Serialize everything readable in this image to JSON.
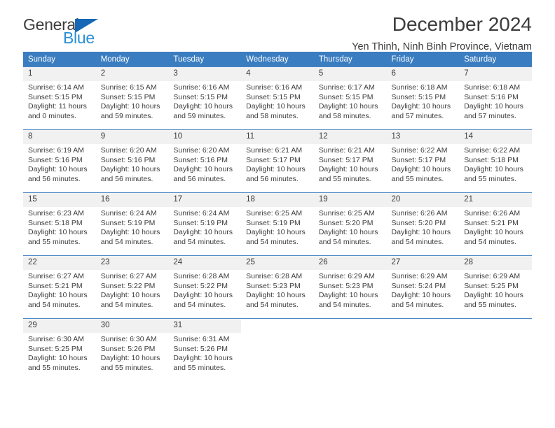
{
  "brand": {
    "word_one": "General",
    "word_two": "Blue",
    "triangle": "triangle-logo-mark"
  },
  "header": {
    "title": "December 2024",
    "subtitle": "Yen Thinh, Ninh Binh Province, Vietnam"
  },
  "colors": {
    "header_blue": "#3a7dc0",
    "row_border_blue": "#4a86c5",
    "daynum_bg": "#f1f1f1",
    "brand_blue": "#2a8fd4",
    "brand_triangle": "#1567b5",
    "text": "#3c3c3c"
  },
  "weekday_headers": [
    "Sunday",
    "Monday",
    "Tuesday",
    "Wednesday",
    "Thursday",
    "Friday",
    "Saturday"
  ],
  "labels": {
    "sunrise_prefix": "Sunrise: ",
    "sunset_prefix": "Sunset: ",
    "daylight_prefix": "Daylight: "
  },
  "weeks": [
    [
      {
        "day": "1",
        "sunrise": "Sunrise: 6:14 AM",
        "sunset": "Sunset: 5:15 PM",
        "daylight": "Daylight: 11 hours and 0 minutes."
      },
      {
        "day": "2",
        "sunrise": "Sunrise: 6:15 AM",
        "sunset": "Sunset: 5:15 PM",
        "daylight": "Daylight: 10 hours and 59 minutes."
      },
      {
        "day": "3",
        "sunrise": "Sunrise: 6:16 AM",
        "sunset": "Sunset: 5:15 PM",
        "daylight": "Daylight: 10 hours and 59 minutes."
      },
      {
        "day": "4",
        "sunrise": "Sunrise: 6:16 AM",
        "sunset": "Sunset: 5:15 PM",
        "daylight": "Daylight: 10 hours and 58 minutes."
      },
      {
        "day": "5",
        "sunrise": "Sunrise: 6:17 AM",
        "sunset": "Sunset: 5:15 PM",
        "daylight": "Daylight: 10 hours and 58 minutes."
      },
      {
        "day": "6",
        "sunrise": "Sunrise: 6:18 AM",
        "sunset": "Sunset: 5:15 PM",
        "daylight": "Daylight: 10 hours and 57 minutes."
      },
      {
        "day": "7",
        "sunrise": "Sunrise: 6:18 AM",
        "sunset": "Sunset: 5:16 PM",
        "daylight": "Daylight: 10 hours and 57 minutes."
      }
    ],
    [
      {
        "day": "8",
        "sunrise": "Sunrise: 6:19 AM",
        "sunset": "Sunset: 5:16 PM",
        "daylight": "Daylight: 10 hours and 56 minutes."
      },
      {
        "day": "9",
        "sunrise": "Sunrise: 6:20 AM",
        "sunset": "Sunset: 5:16 PM",
        "daylight": "Daylight: 10 hours and 56 minutes."
      },
      {
        "day": "10",
        "sunrise": "Sunrise: 6:20 AM",
        "sunset": "Sunset: 5:16 PM",
        "daylight": "Daylight: 10 hours and 56 minutes."
      },
      {
        "day": "11",
        "sunrise": "Sunrise: 6:21 AM",
        "sunset": "Sunset: 5:17 PM",
        "daylight": "Daylight: 10 hours and 56 minutes."
      },
      {
        "day": "12",
        "sunrise": "Sunrise: 6:21 AM",
        "sunset": "Sunset: 5:17 PM",
        "daylight": "Daylight: 10 hours and 55 minutes."
      },
      {
        "day": "13",
        "sunrise": "Sunrise: 6:22 AM",
        "sunset": "Sunset: 5:17 PM",
        "daylight": "Daylight: 10 hours and 55 minutes."
      },
      {
        "day": "14",
        "sunrise": "Sunrise: 6:22 AM",
        "sunset": "Sunset: 5:18 PM",
        "daylight": "Daylight: 10 hours and 55 minutes."
      }
    ],
    [
      {
        "day": "15",
        "sunrise": "Sunrise: 6:23 AM",
        "sunset": "Sunset: 5:18 PM",
        "daylight": "Daylight: 10 hours and 55 minutes."
      },
      {
        "day": "16",
        "sunrise": "Sunrise: 6:24 AM",
        "sunset": "Sunset: 5:19 PM",
        "daylight": "Daylight: 10 hours and 54 minutes."
      },
      {
        "day": "17",
        "sunrise": "Sunrise: 6:24 AM",
        "sunset": "Sunset: 5:19 PM",
        "daylight": "Daylight: 10 hours and 54 minutes."
      },
      {
        "day": "18",
        "sunrise": "Sunrise: 6:25 AM",
        "sunset": "Sunset: 5:19 PM",
        "daylight": "Daylight: 10 hours and 54 minutes."
      },
      {
        "day": "19",
        "sunrise": "Sunrise: 6:25 AM",
        "sunset": "Sunset: 5:20 PM",
        "daylight": "Daylight: 10 hours and 54 minutes."
      },
      {
        "day": "20",
        "sunrise": "Sunrise: 6:26 AM",
        "sunset": "Sunset: 5:20 PM",
        "daylight": "Daylight: 10 hours and 54 minutes."
      },
      {
        "day": "21",
        "sunrise": "Sunrise: 6:26 AM",
        "sunset": "Sunset: 5:21 PM",
        "daylight": "Daylight: 10 hours and 54 minutes."
      }
    ],
    [
      {
        "day": "22",
        "sunrise": "Sunrise: 6:27 AM",
        "sunset": "Sunset: 5:21 PM",
        "daylight": "Daylight: 10 hours and 54 minutes."
      },
      {
        "day": "23",
        "sunrise": "Sunrise: 6:27 AM",
        "sunset": "Sunset: 5:22 PM",
        "daylight": "Daylight: 10 hours and 54 minutes."
      },
      {
        "day": "24",
        "sunrise": "Sunrise: 6:28 AM",
        "sunset": "Sunset: 5:22 PM",
        "daylight": "Daylight: 10 hours and 54 minutes."
      },
      {
        "day": "25",
        "sunrise": "Sunrise: 6:28 AM",
        "sunset": "Sunset: 5:23 PM",
        "daylight": "Daylight: 10 hours and 54 minutes."
      },
      {
        "day": "26",
        "sunrise": "Sunrise: 6:29 AM",
        "sunset": "Sunset: 5:23 PM",
        "daylight": "Daylight: 10 hours and 54 minutes."
      },
      {
        "day": "27",
        "sunrise": "Sunrise: 6:29 AM",
        "sunset": "Sunset: 5:24 PM",
        "daylight": "Daylight: 10 hours and 54 minutes."
      },
      {
        "day": "28",
        "sunrise": "Sunrise: 6:29 AM",
        "sunset": "Sunset: 5:25 PM",
        "daylight": "Daylight: 10 hours and 55 minutes."
      }
    ],
    [
      {
        "day": "29",
        "sunrise": "Sunrise: 6:30 AM",
        "sunset": "Sunset: 5:25 PM",
        "daylight": "Daylight: 10 hours and 55 minutes."
      },
      {
        "day": "30",
        "sunrise": "Sunrise: 6:30 AM",
        "sunset": "Sunset: 5:26 PM",
        "daylight": "Daylight: 10 hours and 55 minutes."
      },
      {
        "day": "31",
        "sunrise": "Sunrise: 6:31 AM",
        "sunset": "Sunset: 5:26 PM",
        "daylight": "Daylight: 10 hours and 55 minutes."
      },
      null,
      null,
      null,
      null
    ]
  ]
}
